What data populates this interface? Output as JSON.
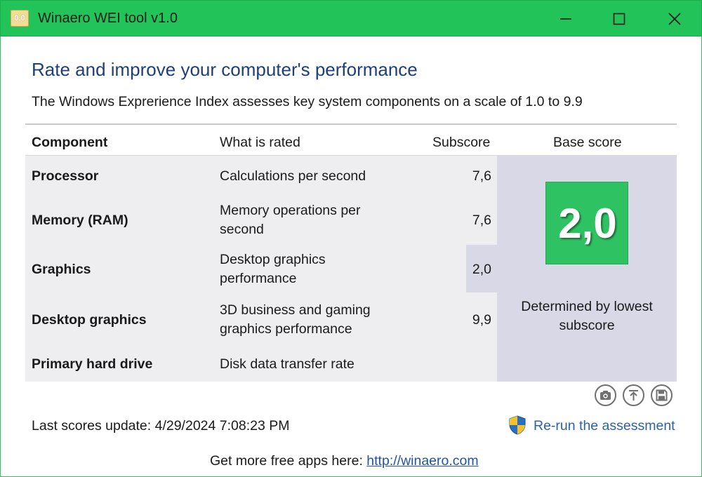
{
  "window": {
    "title": "Winaero WEI tool v1.0",
    "icon_label": "0,0",
    "accent_color": "#22c45a"
  },
  "main": {
    "heading": "Rate and improve your computer's performance",
    "subtitle": "The Windows Exprerience Index assesses key system components on a scale of 1.0 to 9.9"
  },
  "table": {
    "columns": {
      "component": "Component",
      "what": "What is rated",
      "subscore": "Subscore",
      "base": "Base score"
    },
    "rows": [
      {
        "component": "Processor",
        "what": "Calculations per second",
        "subscore": "7,6"
      },
      {
        "component": "Memory (RAM)",
        "what": "Memory operations per second",
        "subscore": "7,6"
      },
      {
        "component": "Graphics",
        "what": "Desktop graphics performance",
        "subscore": "2,0"
      },
      {
        "component": "Desktop graphics",
        "what": "3D business and gaming graphics performance",
        "subscore": "9,9"
      },
      {
        "component": "Primary hard drive",
        "what": "Disk data transfer rate",
        "subscore": ""
      }
    ],
    "base_score": "2,0",
    "base_note": "Determined by lowest subscore",
    "score_color": "#2ec262"
  },
  "toolbar": {
    "icons": [
      "camera-icon",
      "upload-icon",
      "save-icon"
    ]
  },
  "status": {
    "last_update_label": "Last scores update:",
    "last_update_value": "4/29/2024 7:08:23 PM",
    "rerun_label": "Re-run the assessment"
  },
  "footer": {
    "text": "Get more free apps here:",
    "link": "http://winaero.com"
  }
}
